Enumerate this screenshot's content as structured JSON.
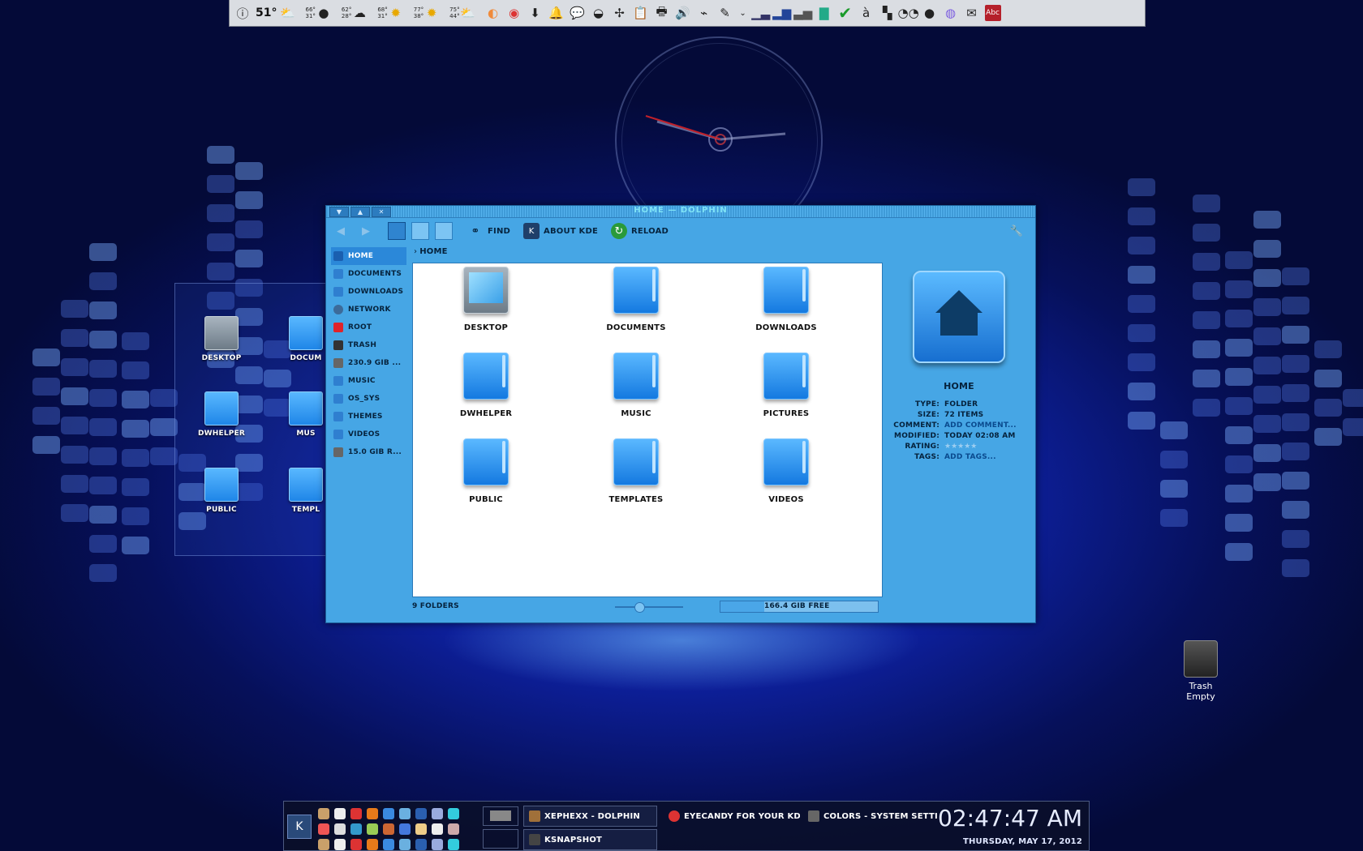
{
  "top_panel": {
    "weather": [
      {
        "temp": "51°",
        "hi": "",
        "lo": ""
      },
      {
        "temp": "",
        "hi": "66°",
        "lo": "31°"
      },
      {
        "temp": "",
        "hi": "62°",
        "lo": "28°"
      },
      {
        "temp": "",
        "hi": "68°",
        "lo": "31°"
      },
      {
        "temp": "",
        "hi": "77°",
        "lo": "38°"
      },
      {
        "temp": "",
        "hi": "75°",
        "lo": "44°"
      }
    ],
    "spell_label": "Abc"
  },
  "desktop": {
    "folder_view": [
      {
        "label": "Desktop"
      },
      {
        "label": "Docum"
      },
      {
        "label": "DWHelper"
      },
      {
        "label": "Mus"
      },
      {
        "label": "Public"
      },
      {
        "label": "Templ"
      }
    ],
    "trash": {
      "label": "Trash",
      "state": "Empty"
    }
  },
  "window": {
    "title": "Home — Dolphin",
    "toolbar": {
      "find": "Find",
      "about": "About KDE",
      "reload": "Reload"
    },
    "breadcrumb": "Home",
    "places": [
      {
        "label": "Home",
        "selected": true
      },
      {
        "label": "Documents"
      },
      {
        "label": "Downloads"
      },
      {
        "label": "Network"
      },
      {
        "label": "Root"
      },
      {
        "label": "Trash"
      },
      {
        "label": "230.9 GiB ..."
      },
      {
        "label": "Music"
      },
      {
        "label": "OS_SYS"
      },
      {
        "label": "Themes"
      },
      {
        "label": "Videos"
      },
      {
        "label": "15.0 GiB R..."
      }
    ],
    "files": [
      {
        "label": "Desktop"
      },
      {
        "label": "Documents"
      },
      {
        "label": "Downloads"
      },
      {
        "label": "DWHelper"
      },
      {
        "label": "Music"
      },
      {
        "label": "Pictures"
      },
      {
        "label": "Public"
      },
      {
        "label": "Templates"
      },
      {
        "label": "Videos"
      }
    ],
    "status": {
      "count": "9 Folders",
      "free": "166.4 GiB free"
    },
    "info": {
      "name": "Home",
      "rows": [
        {
          "k": "Type:",
          "v": "Folder"
        },
        {
          "k": "Size:",
          "v": "72 items"
        },
        {
          "k": "Comment:",
          "v": "Add Comment..."
        },
        {
          "k": "Modified:",
          "v": "Today 02:08 AM"
        },
        {
          "k": "Rating:",
          "v": "★★★★★"
        },
        {
          "k": "Tags:",
          "v": "Add Tags..."
        }
      ]
    }
  },
  "taskbar": {
    "tasks": [
      {
        "label": "xephexx - Dolphin"
      },
      {
        "label": "KSnapshot"
      },
      {
        "label": "Eyecandy for your KDE"
      },
      {
        "label": "Colors - System Setti"
      }
    ],
    "time": "02:47:47 AM",
    "date": "Thursday, May 17, 2012"
  }
}
